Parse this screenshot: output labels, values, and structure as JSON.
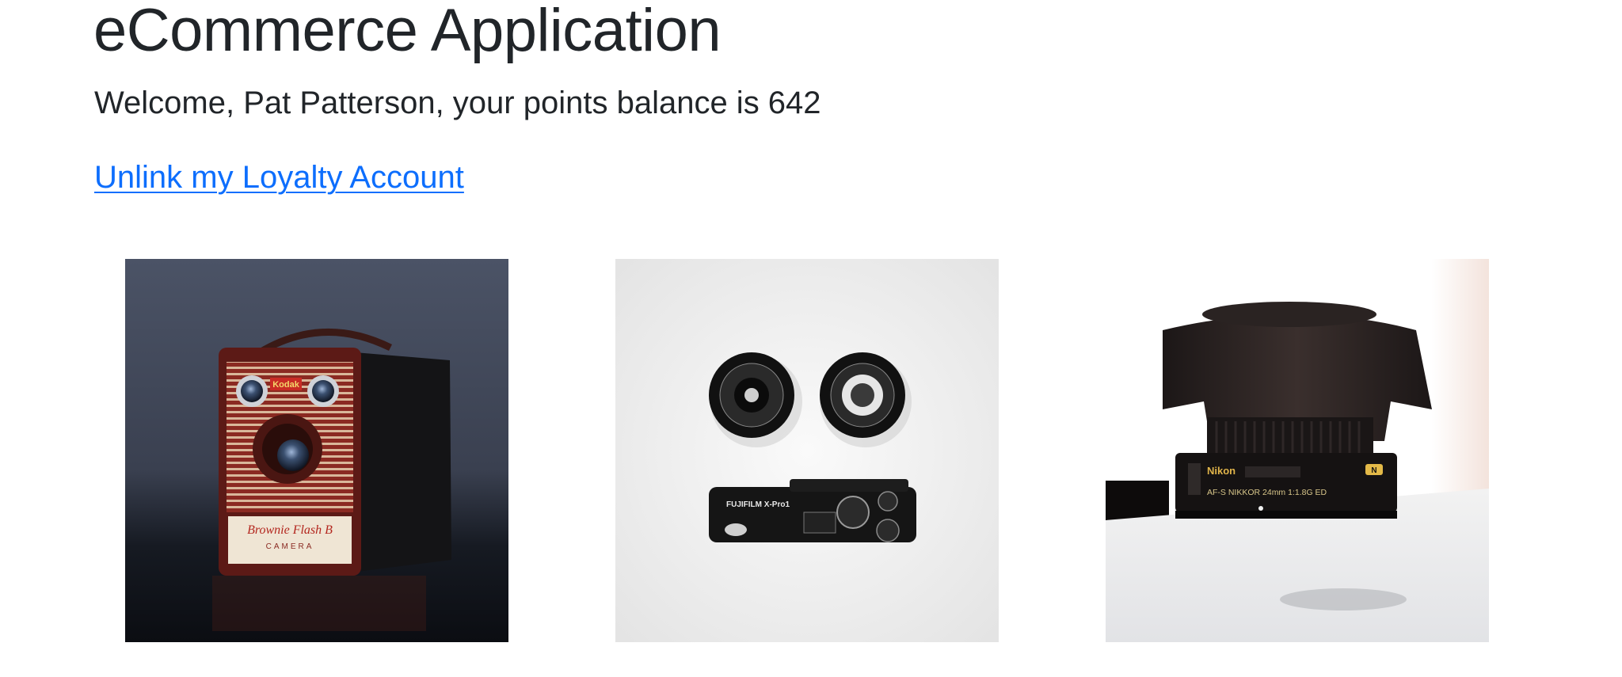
{
  "header": {
    "title": "eCommerce Application",
    "welcome": "Welcome, Pat Patterson, your points balance is 642",
    "unlink_label": "Unlink my Loyalty Account"
  },
  "products": [
    {
      "image": "kodak-brownie-flash-b-camera",
      "text_on_image": [
        "Kodak",
        "Brownie Flash B",
        "CAMERA"
      ]
    },
    {
      "image": "fujifilm-x-pro1-with-lenses",
      "text_on_image": [
        "FUJIFILM X-Pro1"
      ]
    },
    {
      "image": "nikon-nikkor-24mm-lens",
      "text_on_image": [
        "Nikon",
        "AF-S NIKKOR 24mm 1:1.8G ED",
        "N"
      ]
    }
  ],
  "colors": {
    "text": "#212529",
    "link": "#0d6efd",
    "background": "#ffffff"
  }
}
